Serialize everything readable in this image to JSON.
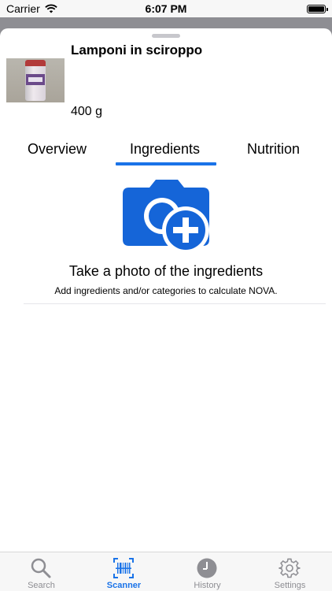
{
  "status_bar": {
    "carrier": "Carrier",
    "time": "6:07 PM"
  },
  "product": {
    "name": "Lamponi in sciroppo",
    "quantity": "400 g"
  },
  "tabs": [
    {
      "label": "Overview"
    },
    {
      "label": "Ingredients"
    },
    {
      "label": "Nutrition"
    }
  ],
  "active_tab": "Ingredients",
  "ingredients": {
    "title": "Take a photo of the ingredients",
    "subtitle": "Add ingredients and/or categories to calculate NOVA."
  },
  "tabbar": {
    "items": [
      {
        "label": "Search",
        "icon": "search-icon"
      },
      {
        "label": "Scanner",
        "icon": "barcode-scanner-icon"
      },
      {
        "label": "History",
        "icon": "clock-icon"
      },
      {
        "label": "Settings",
        "icon": "gear-icon"
      }
    ],
    "active": "Scanner"
  },
  "colors": {
    "accent": "#1a73e8",
    "camera": "#1565d8",
    "inactive": "#8e8e93"
  }
}
